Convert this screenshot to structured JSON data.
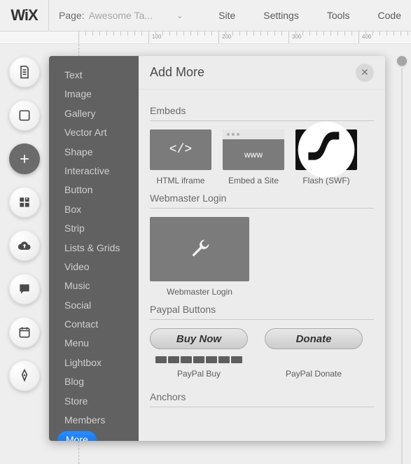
{
  "top": {
    "logo": "WiX",
    "page_label": "Page:",
    "page_name": "Awesome Ta...",
    "menu": [
      "Site",
      "Settings",
      "Tools",
      "Code"
    ]
  },
  "ruler": {
    "majors": [
      100,
      200,
      300,
      400
    ]
  },
  "rail_icons": [
    "page-icon",
    "section-icon",
    "add-icon",
    "apps-icon",
    "upload-icon",
    "chat-icon",
    "calendar-icon",
    "pen-icon"
  ],
  "panel": {
    "title": "Add More",
    "categories": [
      "Text",
      "Image",
      "Gallery",
      "Vector Art",
      "Shape",
      "Interactive",
      "Button",
      "Box",
      "Strip",
      "Lists & Grids",
      "Video",
      "Music",
      "Social",
      "Contact",
      "Menu",
      "Lightbox",
      "Blog",
      "Store",
      "Members",
      "More"
    ],
    "selected": "More",
    "sections": {
      "embeds": {
        "title": "Embeds",
        "items": [
          {
            "icon": "code-icon",
            "label": "HTML iframe",
            "inner": "</>"
          },
          {
            "icon": "browser-icon",
            "label": "Embed a Site",
            "inner": "www"
          },
          {
            "icon": "flash-icon",
            "label": "Flash (SWF)",
            "inner": ""
          }
        ]
      },
      "webmaster": {
        "title": "Webmaster Login",
        "item_label": "Webmaster Login"
      },
      "paypal": {
        "title": "Paypal Buttons",
        "items": [
          {
            "button": "Buy Now",
            "label": "PayPal Buy",
            "cards": true
          },
          {
            "button": "Donate",
            "label": "PayPal Donate",
            "cards": false
          }
        ]
      },
      "anchors": {
        "title": "Anchors"
      }
    }
  }
}
